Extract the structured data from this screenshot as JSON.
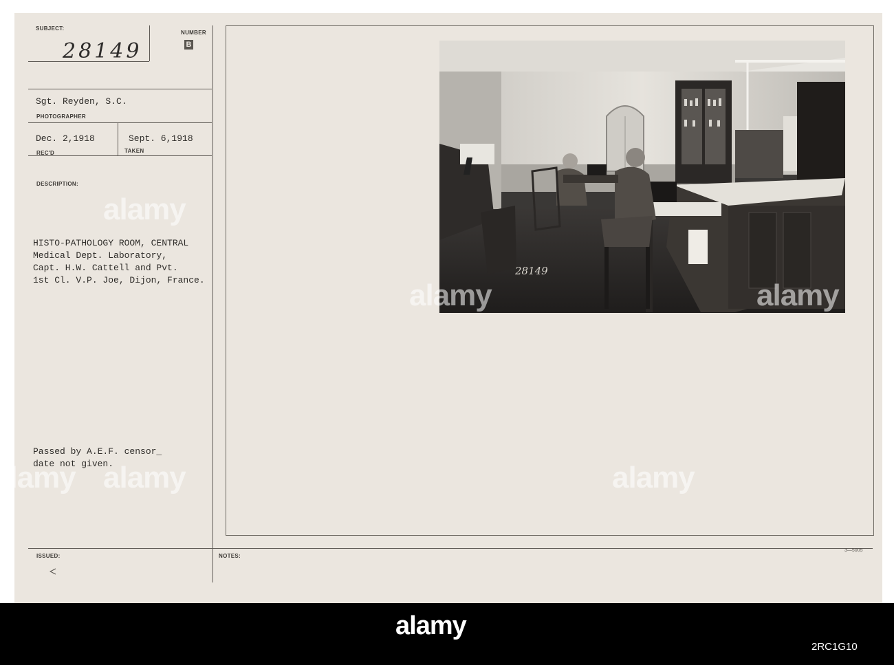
{
  "labels": {
    "subject": "SUBJECT:",
    "number": "NUMBER",
    "photographer": "PHOTOGRAPHER",
    "recd": "REC'D",
    "taken": "TAKEN",
    "description": "DESCRIPTION:",
    "issued": "ISSUED:",
    "notes": "NOTES:"
  },
  "record": {
    "subject_number": "28149",
    "number_mark": "B",
    "photographer": "Sgt. Reyden, S.C.",
    "received": "Dec. 2,1918",
    "taken": "Sept. 6,1918",
    "description": [
      "HISTO-PATHOLOGY ROOM, CENTRAL",
      "Medical Dept. Laboratory,",
      "Capt. H.W. Cattell and Pvt.",
      "1st Cl. V.P. Joe, Dijon, France."
    ],
    "censor": [
      "Passed by A.E.F. censor_",
      "date not given."
    ],
    "form_code": "3—5005",
    "photo_caption": "28149"
  },
  "watermarks": {
    "text": "alamy"
  },
  "footer": {
    "brand": "alamy",
    "image_id": "2RC1G10"
  }
}
